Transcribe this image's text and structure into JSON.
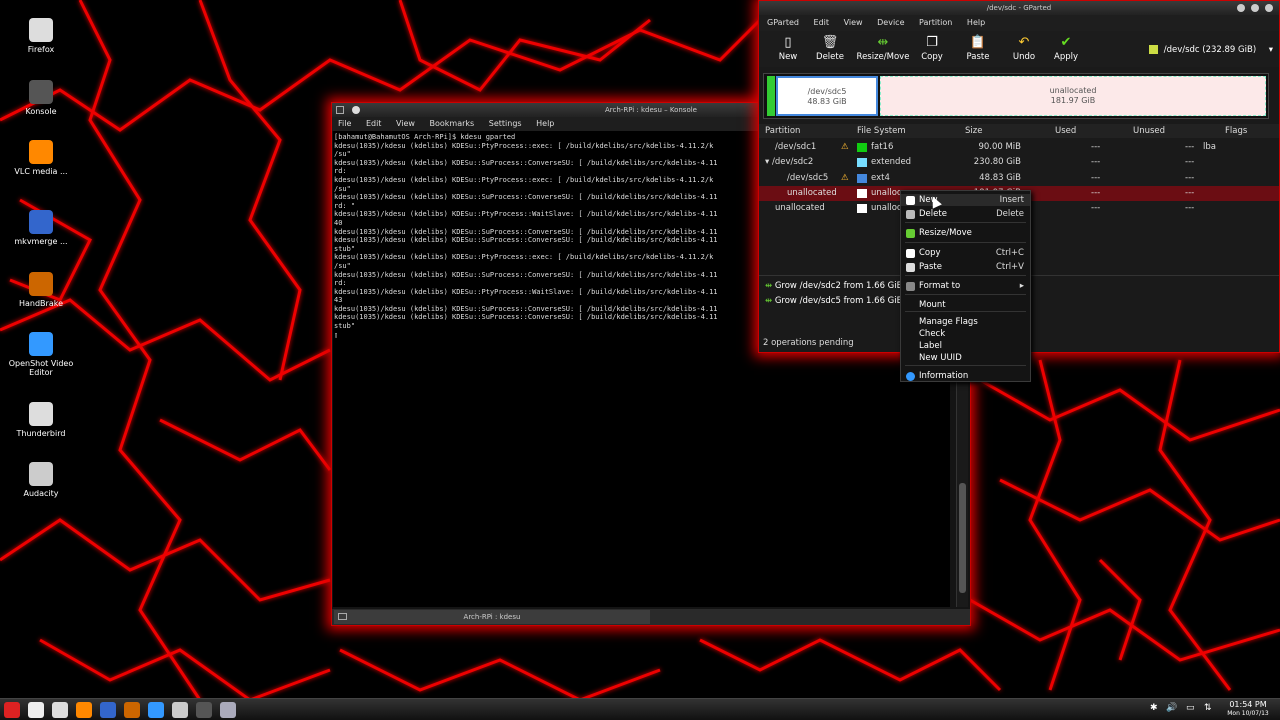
{
  "desktop": {
    "icons": [
      {
        "label": "Firefox",
        "color": "#ddd"
      },
      {
        "label": "Konsole",
        "color": "#555"
      },
      {
        "label": "VLC media ...",
        "color": "#f80"
      },
      {
        "label": "mkvmerge ...",
        "color": "#36c"
      },
      {
        "label": "HandBrake",
        "color": "#c60"
      },
      {
        "label": "OpenShot Video Editor",
        "color": "#39f"
      },
      {
        "label": "Thunderbird",
        "color": "#ddd"
      },
      {
        "label": "Audacity",
        "color": "#ccc"
      }
    ]
  },
  "konsole": {
    "title": "Arch-RPi : kdesu – Konsole",
    "menu": [
      "File",
      "Edit",
      "View",
      "Bookmarks",
      "Settings",
      "Help"
    ],
    "tab": "Arch-RPi : kdesu",
    "lines": [
      "[bahamut@BahamutOS Arch-RPi]$ kdesu gparted",
      "kdesu(1035)/kdesu (kdelibs) KDESu::PtyProcess::exec: [ /build/kdelibs/src/kdelibs-4.11.2/k",
      "/su\"",
      "kdesu(1035)/kdesu (kdelibs) KDESu::SuProcess::ConverseSU: [ /build/kdelibs/src/kdelibs-4.11",
      "rd:",
      "kdesu(1035)/kdesu (kdelibs) KDESu::PtyProcess::exec: [ /build/kdelibs/src/kdelibs-4.11.2/k",
      "/su\"",
      "kdesu(1035)/kdesu (kdelibs) KDESu::SuProcess::ConverseSU: [ /build/kdelibs/src/kdelibs-4.11",
      "rd: \"",
      "kdesu(1035)/kdesu (kdelibs) KDESu::PtyProcess::WaitSlave: [ /build/kdelibs/src/kdelibs-4.11",
      "40",
      "kdesu(1035)/kdesu (kdelibs) KDESu::SuProcess::ConverseSU: [ /build/kdelibs/src/kdelibs-4.11",
      "kdesu(1035)/kdesu (kdelibs) KDESu::SuProcess::ConverseSU: [ /build/kdelibs/src/kdelibs-4.11",
      "stub\"",
      "kdesu(1035)/kdesu (kdelibs) KDESu::PtyProcess::exec: [ /build/kdelibs/src/kdelibs-4.11.2/k",
      "/su\"",
      "kdesu(1035)/kdesu (kdelibs) KDESu::SuProcess::ConverseSU: [ /build/kdelibs/src/kdelibs-4.11",
      "rd:",
      "kdesu(1035)/kdesu (kdelibs) KDESu::PtyProcess::WaitSlave: [ /build/kdelibs/src/kdelibs-4.11",
      "43",
      "kdesu(1035)/kdesu (kdelibs) KDESu::SuProcess::ConverseSU: [ /build/kdelibs/src/kdelibs-4.11",
      "kdesu(1035)/kdesu (kdelibs) KDESu::SuProcess::ConverseSU: [ /build/kdelibs/src/kdelibs-4.11",
      "stub\"",
      "▯"
    ]
  },
  "gparted": {
    "title": "/dev/sdc - GParted",
    "menu": [
      "GParted",
      "Edit",
      "View",
      "Device",
      "Partition",
      "Help"
    ],
    "toolbar": [
      {
        "label": "New",
        "icon": "new-icon",
        "glyph": "▯",
        "color": "#fff"
      },
      {
        "label": "Delete",
        "icon": "delete-icon",
        "glyph": "🗑",
        "color": "#ddd"
      },
      {
        "label": "Resize/Move",
        "icon": "resize-icon",
        "glyph": "⇹",
        "color": "#6c3"
      },
      {
        "label": "Copy",
        "icon": "copy-icon",
        "glyph": "❐",
        "color": "#fff"
      },
      {
        "label": "Paste",
        "icon": "paste-icon",
        "glyph": "📋",
        "color": "#eee"
      },
      {
        "label": "Undo",
        "icon": "undo-icon",
        "glyph": "↶",
        "color": "#fc3"
      },
      {
        "label": "Apply",
        "icon": "apply-icon",
        "glyph": "✔",
        "color": "#6d2"
      }
    ],
    "device": "/dev/sdc  (232.89 GiB)",
    "map": {
      "sdc5_name": "/dev/sdc5",
      "sdc5_size": "48.83 GiB",
      "unalloc_name": "unallocated",
      "unalloc_size": "181.97 GiB"
    },
    "headers": [
      "Partition",
      "File System",
      "Size",
      "Used",
      "Unused",
      "Flags"
    ],
    "rows": [
      {
        "part": "/dev/sdc1",
        "fs": "fat16",
        "fscolor": "#1c1",
        "size": "90.00 MiB",
        "used": "---",
        "unused": "---",
        "flags": "lba",
        "warn": true
      },
      {
        "part": "▾ /dev/sdc2",
        "fs": "extended",
        "fscolor": "#7df",
        "size": "230.80 GiB",
        "used": "---",
        "unused": "---",
        "flags": "",
        "warn": false
      },
      {
        "part": "/dev/sdc5",
        "fs": "ext4",
        "fscolor": "#48d",
        "size": "48.83 GiB",
        "used": "---",
        "unused": "---",
        "flags": "",
        "warn": true
      },
      {
        "part": "unallocated",
        "fs": "unalloc",
        "fscolor": "#fff",
        "size": "181.97 GiB",
        "used": "---",
        "unused": "---",
        "flags": "",
        "warn": false
      },
      {
        "part": "unallocated",
        "fs": "unalloc",
        "fscolor": "#fff",
        "size": "",
        "used": "---",
        "unused": "---",
        "flags": "",
        "warn": false
      }
    ],
    "operations": [
      "Grow /dev/sdc2 from 1.66 GiB",
      "Grow /dev/sdc5 from 1.66 GiB"
    ],
    "status": "2 operations pending"
  },
  "context_menu": {
    "items": [
      {
        "label": "New",
        "shortcut": "Insert",
        "icon": "#fff"
      },
      {
        "label": "Delete",
        "shortcut": "Delete",
        "icon": "#bbb"
      },
      {
        "label": "Resize/Move",
        "shortcut": "",
        "icon": "#6c3"
      },
      {
        "label": "Copy",
        "shortcut": "Ctrl+C",
        "icon": "#fff"
      },
      {
        "label": "Paste",
        "shortcut": "Ctrl+V",
        "icon": "#ddd"
      },
      {
        "label": "Format to",
        "shortcut": "▸",
        "icon": "#888"
      },
      {
        "label": "Mount",
        "shortcut": "",
        "icon": ""
      },
      {
        "label": "Manage Flags",
        "shortcut": "",
        "icon": ""
      },
      {
        "label": "Check",
        "shortcut": "",
        "icon": ""
      },
      {
        "label": "Label",
        "shortcut": "",
        "icon": ""
      },
      {
        "label": "New UUID",
        "shortcut": "",
        "icon": ""
      },
      {
        "label": "Information",
        "shortcut": "",
        "icon": "#39f"
      }
    ]
  },
  "taskbar": {
    "time": "01:54 PM",
    "date": "Mon 10/07/13"
  }
}
